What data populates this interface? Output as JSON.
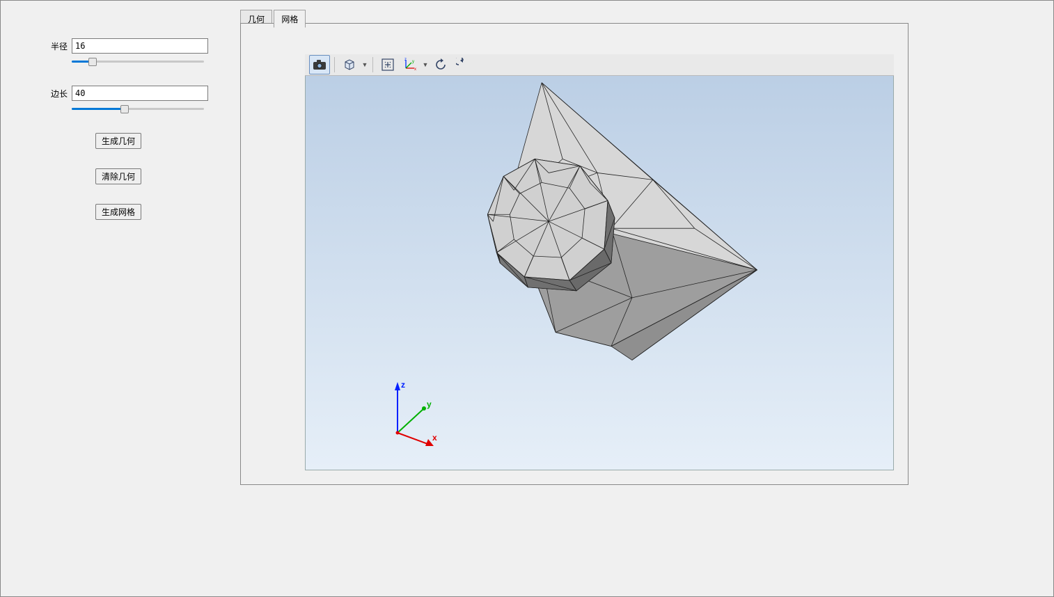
{
  "controls": {
    "radius_label": "半径",
    "radius_value": "16",
    "radius_slider_pct": 16,
    "edge_label": "边长",
    "edge_value": "40",
    "edge_slider_pct": 40
  },
  "buttons": {
    "gen_geom": "生成几何",
    "clear_geom": "清除几何",
    "gen_mesh": "生成网格"
  },
  "tabs": {
    "geom": "几何",
    "mesh": "网格",
    "active": "mesh"
  },
  "toolbar": {
    "camera": "camera-icon",
    "cube": "cube-icon",
    "fit": "fit-view-icon",
    "axes": "axes-icon",
    "rotate_cw": "rotate-cw-icon",
    "rotate_ccw": "rotate-ccw-icon"
  },
  "triad": {
    "x": "x",
    "y": "y",
    "z": "z"
  }
}
